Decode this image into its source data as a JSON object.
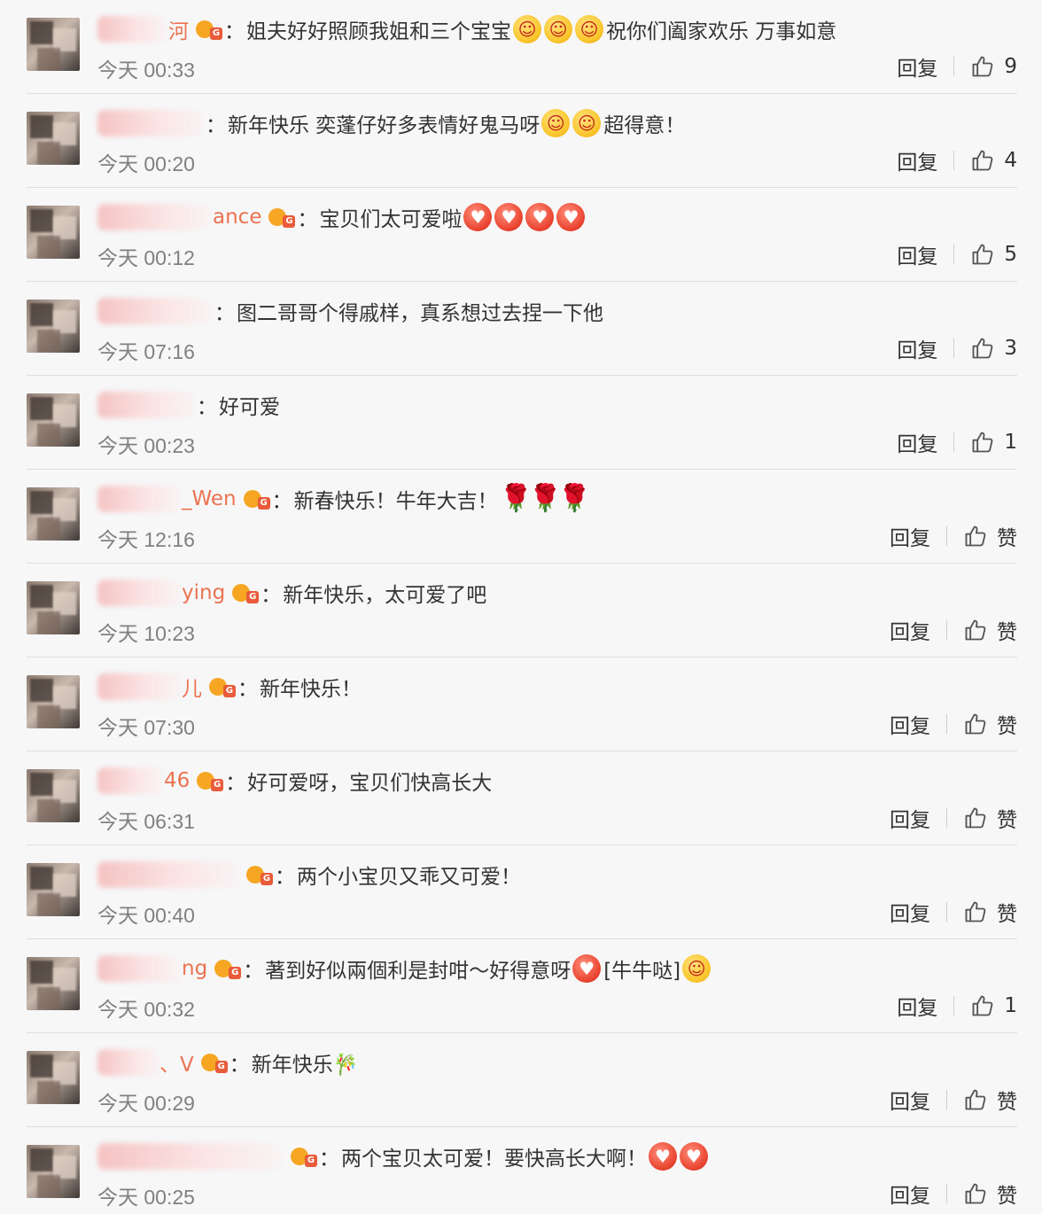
{
  "labels": {
    "reply": "回复"
  },
  "comments": [
    {
      "name_visible": "河",
      "has_badge": true,
      "text": "姐夫好好照顾我姐和三个宝宝",
      "emojis": [
        "face",
        "face",
        "face"
      ],
      "text2": "祝你们阖家欢乐 万事如意",
      "time": "今天 00:33",
      "likes": "9",
      "blur_w": 80
    },
    {
      "name_visible": "",
      "has_badge": false,
      "text": "新年快乐 奕蓬仔好多表情好鬼马呀",
      "emojis": [
        "face",
        "face"
      ],
      "text2": "超得意！",
      "time": "今天 00:20",
      "likes": "4",
      "blur_w": 120
    },
    {
      "name_visible": "ance",
      "has_badge": true,
      "text": "宝贝们太可爱啦",
      "emojis": [
        "red",
        "red",
        "red",
        "red"
      ],
      "text2": "",
      "time": "今天 00:12",
      "likes": "5",
      "blur_w": 130
    },
    {
      "name_visible": "",
      "has_badge": false,
      "text": "图二哥哥个得戚样，真系想过去捏一下他",
      "emojis": [],
      "text2": "",
      "time": "今天 07:16",
      "likes": "3",
      "blur_w": 130
    },
    {
      "name_visible": "",
      "has_badge": false,
      "text": "好可爱",
      "emojis": [],
      "text2": "",
      "time": "今天 00:23",
      "likes": "1",
      "blur_w": 110
    },
    {
      "name_visible": "_Wen",
      "has_badge": true,
      "text": "新春快乐！牛年大吉！",
      "emojis": [
        "rose",
        "rose",
        "rose"
      ],
      "text2": "",
      "time": "今天 12:16",
      "likes": "赞",
      "blur_w": 95
    },
    {
      "name_visible": "ying",
      "has_badge": true,
      "text": "新年快乐，太可爱了吧",
      "emojis": [],
      "text2": "",
      "time": "今天 10:23",
      "likes": "赞",
      "blur_w": 95
    },
    {
      "name_visible": "儿",
      "has_badge": true,
      "text": "新年快乐！",
      "emojis": [],
      "text2": "",
      "time": "今天 07:30",
      "likes": "赞",
      "blur_w": 95
    },
    {
      "name_visible": "46",
      "has_badge": true,
      "text": "好可爱呀，宝贝们快高长大",
      "emojis": [],
      "text2": "",
      "time": "今天 06:31",
      "likes": "赞",
      "blur_w": 75
    },
    {
      "name_visible": "",
      "has_badge": true,
      "text": "两个小宝贝又乖又可爱！",
      "emojis": [],
      "text2": "",
      "time": "今天 00:40",
      "likes": "赞",
      "blur_w": 160
    },
    {
      "name_visible": "ng",
      "has_badge": true,
      "text": "著到好似兩個利是封咁～好得意呀",
      "emojis": [
        "red"
      ],
      "text2": "[牛牛哒]",
      "emojis2": [
        "face"
      ],
      "time": "今天 00:32",
      "likes": "1",
      "blur_w": 95
    },
    {
      "name_visible": "、V",
      "has_badge": true,
      "text": "新年快乐🎋",
      "emojis": [],
      "text2": "",
      "time": "今天 00:29",
      "likes": "赞",
      "blur_w": 70
    },
    {
      "name_visible": "",
      "has_badge": true,
      "text": "两个宝贝太可爱！要快高长大啊！",
      "emojis": [
        "red",
        "red"
      ],
      "text2": "",
      "time": "今天 00:25",
      "likes": "赞",
      "blur_w": 210
    }
  ]
}
